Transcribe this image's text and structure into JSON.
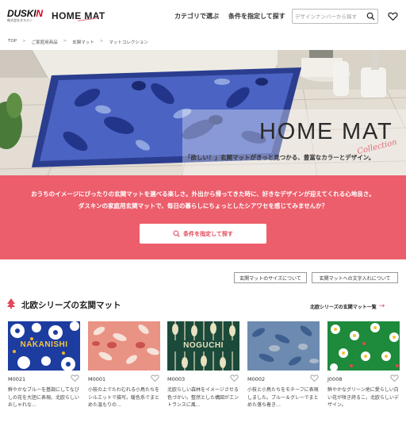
{
  "header": {
    "logo_text_1": "DUSKI",
    "logo_text_2": "N",
    "logo_sub": "株式会社ダスキン",
    "brand": "HOME MAT",
    "nav": {
      "by_category": "カテゴリで選ぶ",
      "by_condition": "条件を指定して探す"
    },
    "search": {
      "placeholder": "デザインナンバーから探す",
      "value": ""
    }
  },
  "breadcrumb": {
    "items": [
      "TOP",
      "ご家庭用商品",
      "玄関マット",
      "マットコレクション"
    ]
  },
  "hero": {
    "title": "HOME MAT",
    "script": "Collection",
    "subtitle": "「欲しい！」玄関マットがきっと見つかる、豊富なカラーとデザイン。"
  },
  "band": {
    "line1": "おうちのイメージにぴったりの玄関マットを選べる楽しさ。外出から帰ってきた時に、好きなデザインが迎えてくれる心地良さ。",
    "line2": "ダスキンの家庭用玄関マットで、毎日の暮らしにちょっとしたシアワセを感じてみませんか？",
    "button_label": "条件を指定して探す"
  },
  "info_buttons": {
    "size": "玄関マットのサイズについて",
    "chars": "玄関マットへの文字入れについて"
  },
  "section": {
    "title": "北欧シリーズの玄関マット",
    "link": "北欧シリーズの玄関マット一覧",
    "link_arrow": "→"
  },
  "products": [
    {
      "code": "M0021",
      "desc": "鮮やかなブルーを基調にしてなびしの花を大胆に表現。北欧らしいおしゃれな…",
      "overlay": "NAKANISHI",
      "bg": "#1c3ca0",
      "accent": "#ffffff"
    },
    {
      "code": "M0001",
      "desc": "小枝の上でたわむれる小鳥たちをシルエットで描写。暖色系でまとめた温もりの…",
      "overlay": "",
      "bg": "#e99384",
      "accent": "#f7e5dc"
    },
    {
      "code": "M0003",
      "desc": "北欧らしい森林をイメージさせる色づかい。整然とした構図がエントランスに風…",
      "overlay": "NOGUCHI",
      "bg": "#1c4a3a",
      "accent": "#e8e2c0"
    },
    {
      "code": "M0002",
      "desc": "小枝と小鳥たちをモチーフに表現しました。ブルー＆グレーでまとめた落ち着き…",
      "overlay": "",
      "bg": "#6d8bb0",
      "accent": "#8ea3bb"
    },
    {
      "code": "J0008",
      "desc": "鮮やかなグリーン地に愛らしい白い花が咲き誇るこ。北欧らしいデザイン。",
      "overlay": "",
      "bg": "#1e8a3c",
      "accent": "#ffffff"
    }
  ],
  "colors": {
    "accent": "#ec5e6c",
    "brand_red": "#d6001c"
  }
}
